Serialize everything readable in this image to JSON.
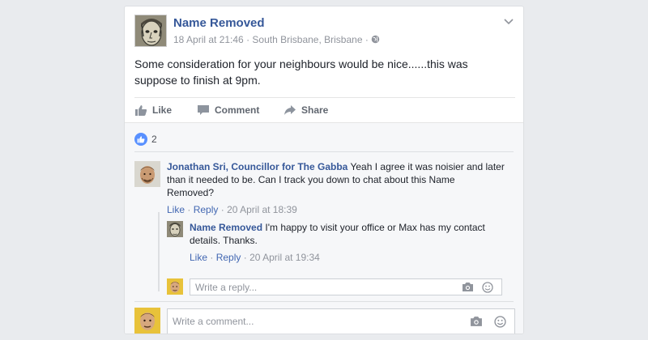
{
  "post": {
    "author": "Name Removed",
    "timestamp": "18 April at 21:46",
    "location": "South Brisbane, Brisbane",
    "separator": "·",
    "audience_icon": "globe-icon",
    "text_line1": "Some consideration for your neighbours would be nice......this was",
    "text_line2": "suppose to finish at 9pm.",
    "menu_icon": "chevron-down-icon"
  },
  "actions": {
    "like": "Like",
    "comment": "Comment",
    "share": "Share"
  },
  "reactions": {
    "count": "2",
    "icon": "thumbs-up-icon"
  },
  "comments": [
    {
      "author": "Jonathan Sri, Councillor for The Gabba",
      "text_part1": " Yeah I agree it was noisier and later",
      "text_line2": "than it needed to be. Can I track you down to chat about this Name",
      "text_line3": "Removed?",
      "like": "Like",
      "reply": "Reply",
      "sep": "·",
      "time": "20 April at 18:39"
    }
  ],
  "replies": [
    {
      "author": "Name Removed",
      "text_part1": " I'm happy to visit your office or Max has my contact",
      "text_line2": "details. Thanks.",
      "like": "Like",
      "reply": "Reply",
      "sep": "·",
      "time": "20 April at 19:34"
    }
  ],
  "reply_input": {
    "placeholder": "Write a reply..."
  },
  "comment_input": {
    "placeholder": "Write a comment..."
  },
  "colors": {
    "link": "#365899",
    "secondary": "#90949c",
    "background": "#e9ebee",
    "like_blue": "#5890ff"
  }
}
